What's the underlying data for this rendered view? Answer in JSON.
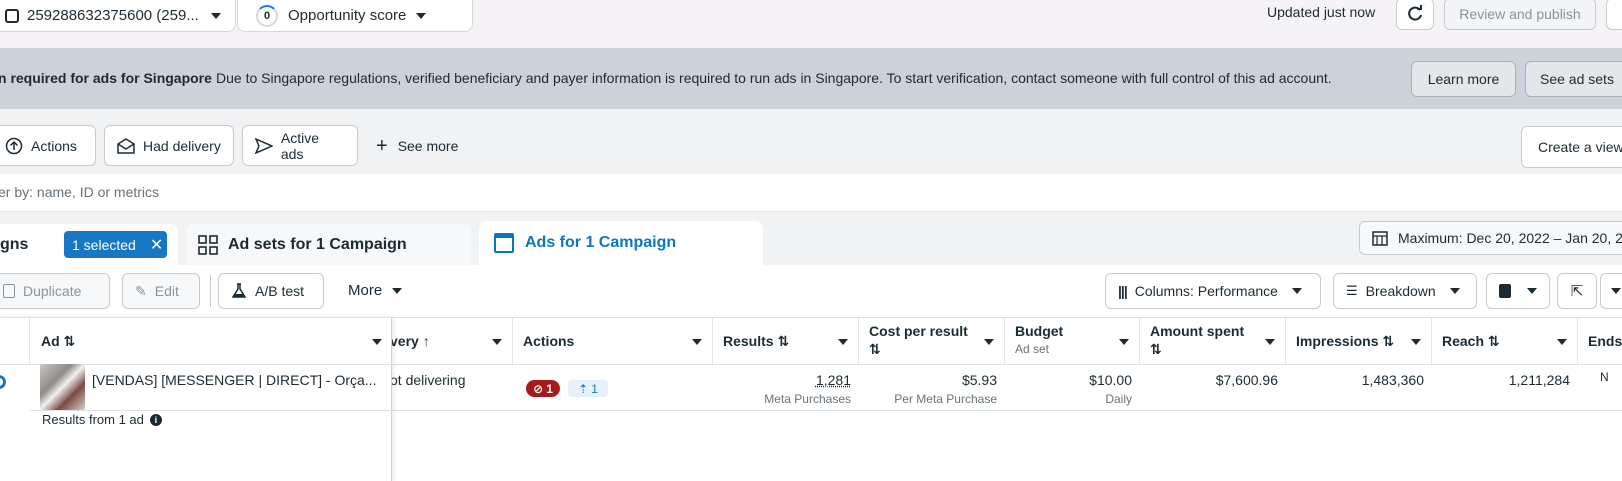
{
  "topbar": {
    "account_label": "259288632375600 (259...",
    "opportunity_count": "0",
    "opportunity_label": "Opportunity score",
    "updated": "Updated just now",
    "review_publish": "Review and publish"
  },
  "banner": {
    "title": "n required for ads for Singapore",
    "text": "Due to Singapore regulations, verified beneficiary and payer information is required to run ads in Singapore. To start verification, contact someone with full control of this ad account.",
    "learn_more": "Learn more",
    "see_ad_sets": "See ad sets"
  },
  "filters": {
    "actions": "Actions",
    "had_delivery": "Had delivery",
    "active_ads": "Active ads",
    "see_more": "See more",
    "create_view": "Create a view"
  },
  "search": {
    "placeholder": "er by: name, ID or metrics"
  },
  "tabs": {
    "campaigns": "gns",
    "selected": "1 selected",
    "adsets": "Ad sets for 1 Campaign",
    "ads": "Ads for 1 Campaign",
    "date_range": "Maximum: Dec 20, 2022 – Jan 20, 2"
  },
  "toolbar": {
    "duplicate": "Duplicate",
    "edit": "Edit",
    "ab_test": "A/B test",
    "more": "More",
    "columns": "Columns: Performance",
    "breakdown": "Breakdown"
  },
  "table": {
    "headers": {
      "ad": "Ad ⇅",
      "delivery": "very ↑",
      "actions": "Actions",
      "results": "Results ⇅",
      "cost_per_result": "Cost per result",
      "cost_sort": "⇅",
      "budget": "Budget",
      "budget_sub": "Ad set",
      "amount_spent": "Amount spent",
      "amount_sort": "⇅",
      "impressions": "Impressions ⇅",
      "reach": "Reach ⇅",
      "ends": "Ends"
    },
    "row": {
      "ad_name": "[VENDAS] [MESSENGER | DIRECT] - Orça...",
      "delivery": "ot delivering",
      "delivery_issue_count": "1",
      "action_count": "1",
      "results": "1,281",
      "results_sub": "Meta Purchases",
      "cost": "$5.93",
      "cost_sub": "Per Meta Purchase",
      "budget": "$10.00",
      "budget_sub": "Daily",
      "amount_spent": "$7,600.96",
      "impressions": "1,483,360",
      "reach": "1,211,284",
      "ends": "N"
    },
    "summary": "Results from 1 ad"
  }
}
